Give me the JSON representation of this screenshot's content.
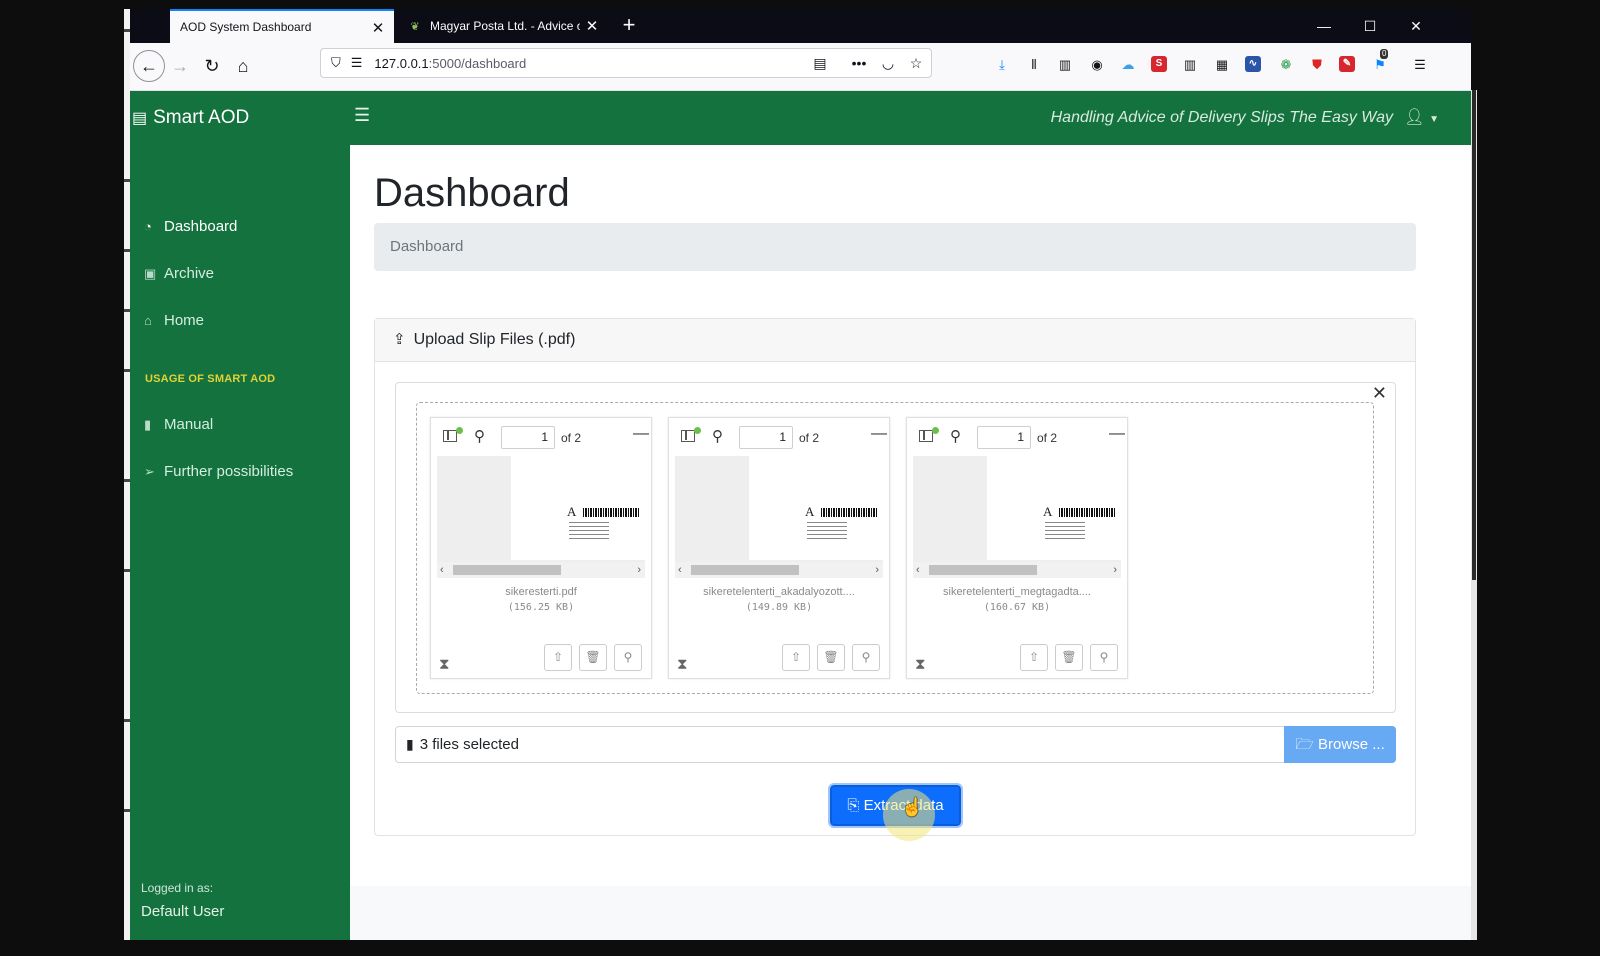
{
  "browser": {
    "tabs": [
      {
        "title": "AOD System Dashboard",
        "active": true
      },
      {
        "title": "Magyar Posta Ltd. - Advice of d",
        "active": false
      }
    ],
    "url_host": "127.0.0.1",
    "url_path": ":5000/dashboard",
    "notification_badge": "0"
  },
  "app": {
    "brand": "Smart AOD",
    "tagline": "Handling Advice of Delivery Slips The Easy Way",
    "accent_color": "#13723e"
  },
  "sidebar": {
    "items": [
      {
        "label": "Dashboard",
        "icon": "tachometer-icon"
      },
      {
        "label": "Archive",
        "icon": "archive-icon"
      },
      {
        "label": "Home",
        "icon": "home-icon"
      }
    ],
    "section_title": "USAGE OF SMART AOD",
    "section_items": [
      {
        "label": "Manual",
        "icon": "book-icon"
      },
      {
        "label": "Further possibilities",
        "icon": "paper-plane-icon"
      }
    ],
    "logged_in_label": "Logged in as:",
    "user": "Default User"
  },
  "main": {
    "title": "Dashboard",
    "breadcrumb": "Dashboard",
    "upload_card": {
      "title": "Upload Slip Files (.pdf)",
      "files": [
        {
          "name": "sikeresterti.pdf",
          "size": "(156.25 KB)",
          "page": "1",
          "of": "of 2",
          "letter": "A"
        },
        {
          "name": "sikeretelenterti_akadalyozott....",
          "size": "(149.89 KB)",
          "page": "1",
          "of": "of 2",
          "letter": "A"
        },
        {
          "name": "sikeretelenterti_megtagadta....",
          "size": "(160.67 KB)",
          "page": "1",
          "of": "of 2",
          "letter": "A"
        }
      ],
      "caption": "3 files selected",
      "browse_label": "Browse ...",
      "extract_label": "Extract data"
    }
  }
}
